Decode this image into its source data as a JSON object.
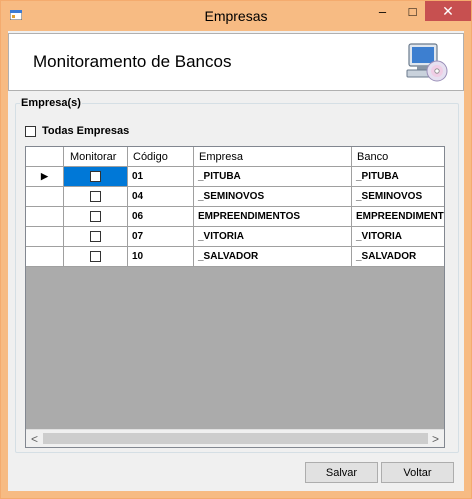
{
  "window": {
    "title": "Empresas",
    "minimize_glyph": "–",
    "maximize_glyph": "□",
    "close_glyph": "✕"
  },
  "header": {
    "title": "Monitoramento de Bancos",
    "icon": "computer-cd-icon"
  },
  "group": {
    "legend": "Empresa(s)",
    "select_all_label": "Todas Empresas",
    "select_all_checked": false
  },
  "grid": {
    "columns": [
      "Monitorar",
      "Código",
      "Empresa",
      "Banco"
    ],
    "current_row_glyph": "▶",
    "rows": [
      {
        "monitorar": false,
        "codigo": "01",
        "empresa": "_PITUBA",
        "banco": "_PITUBA"
      },
      {
        "monitorar": false,
        "codigo": "04",
        "empresa": "_SEMINOVOS",
        "banco": "_SEMINOVOS"
      },
      {
        "monitorar": false,
        "codigo": "06",
        "empresa": "EMPREENDIMENTOS",
        "banco": "EMPREENDIMENTOS"
      },
      {
        "monitorar": false,
        "codigo": "07",
        "empresa": "_VITORIA",
        "banco": "_VITORIA"
      },
      {
        "monitorar": false,
        "codigo": "10",
        "empresa": "_SALVADOR",
        "banco": "_SALVADOR"
      }
    ],
    "scroll_left_glyph": "<",
    "scroll_right_glyph": ">"
  },
  "buttons": {
    "save": "Salvar",
    "back": "Voltar"
  },
  "colors": {
    "titlebar": "#f7bb83",
    "close_button": "#c75050",
    "selection": "#0078d7",
    "grid_background": "#ababab"
  }
}
